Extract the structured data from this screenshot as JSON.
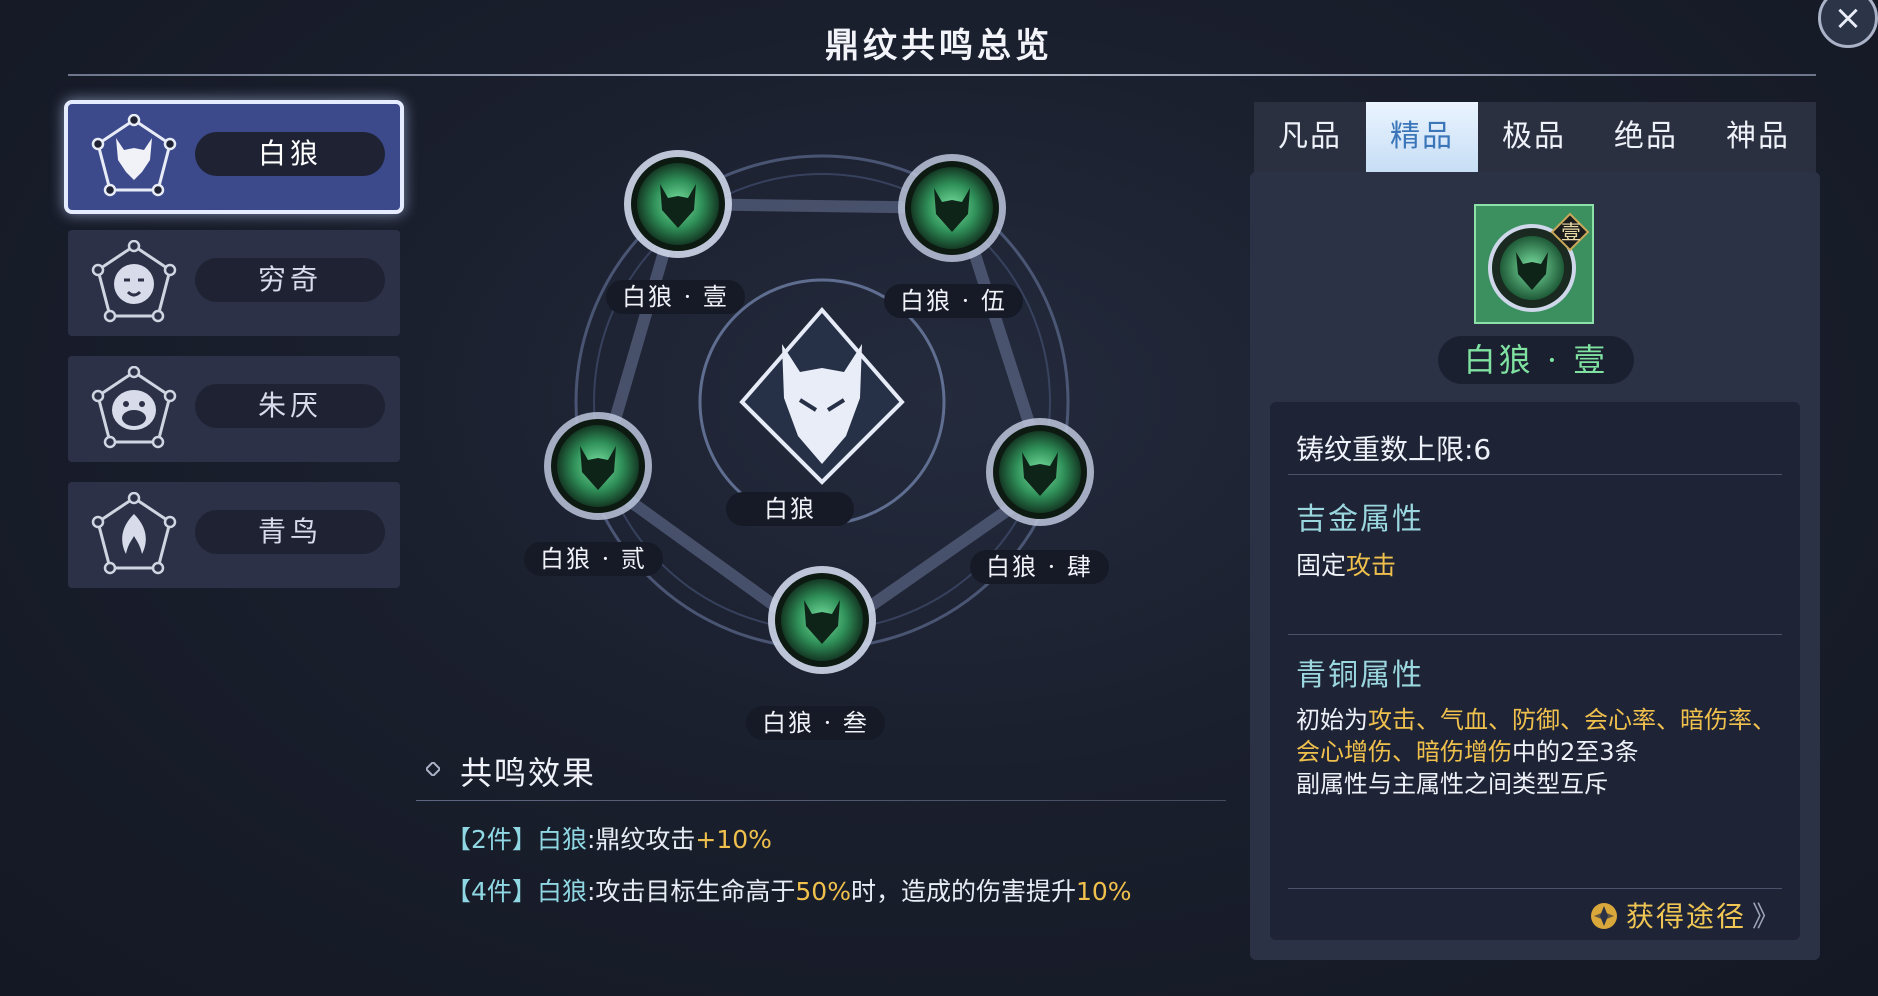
{
  "title": "鼎纹共鸣总览",
  "close_symbol": "×",
  "beasts": [
    {
      "name": "白狼",
      "icon": "wolf-icon",
      "selected": true
    },
    {
      "name": "穷奇",
      "icon": "tiger-icon",
      "selected": false
    },
    {
      "name": "朱厌",
      "icon": "ape-icon",
      "selected": false
    },
    {
      "name": "青鸟",
      "icon": "flame-bird-icon",
      "selected": false
    }
  ],
  "wheel": {
    "center_label": "白狼",
    "nodes": [
      {
        "label": "白狼 · 壹"
      },
      {
        "label": "白狼 · 伍"
      },
      {
        "label": "白狼 · 贰"
      },
      {
        "label": "白狼 · 肆"
      },
      {
        "label": "白狼 · 叁"
      }
    ]
  },
  "effect": {
    "heading": "共鸣效果",
    "rows": [
      {
        "bracket_open": "【",
        "count": "2件",
        "bracket_close": "】",
        "set": "白狼",
        "text_a": ":鼎纹攻击",
        "value": "+10%",
        "text_b": "",
        "value2": ""
      },
      {
        "bracket_open": "【",
        "count": "4件",
        "bracket_close": "】",
        "set": "白狼",
        "text_a": ":攻击目标生命高于",
        "value": "50%",
        "text_b": "时，造成的伤害提升",
        "value2": "10%"
      }
    ]
  },
  "tabs": [
    {
      "label": "凡品",
      "active": false
    },
    {
      "label": "精品",
      "active": true
    },
    {
      "label": "极品",
      "active": false
    },
    {
      "label": "绝品",
      "active": false
    },
    {
      "label": "神品",
      "active": false
    }
  ],
  "item": {
    "badge": "壹",
    "name": "白狼 · 壹",
    "forge_limit": "铸纹重数上限:6",
    "gold_attr_title": "吉金属性",
    "gold_attr_prefix": "固定",
    "gold_attr_value": "攻击",
    "bronze_attr_title": "青铜属性",
    "bronze_prefix": "初始为",
    "bronze_attrs": "攻击、气血、防御、会心率、暗伤率、会心增伤、暗伤增伤",
    "bronze_suffix": "中的2至3条",
    "bronze_note": "副属性与主属性之间类型互斥",
    "source_label": "获得途径",
    "source_arrow": "》"
  },
  "colors": {
    "accent_gold": "#f0c04d",
    "accent_teal": "#8fd8e3",
    "item_green": "#7fe2a0",
    "selected_blue": "#3c4a8c"
  }
}
